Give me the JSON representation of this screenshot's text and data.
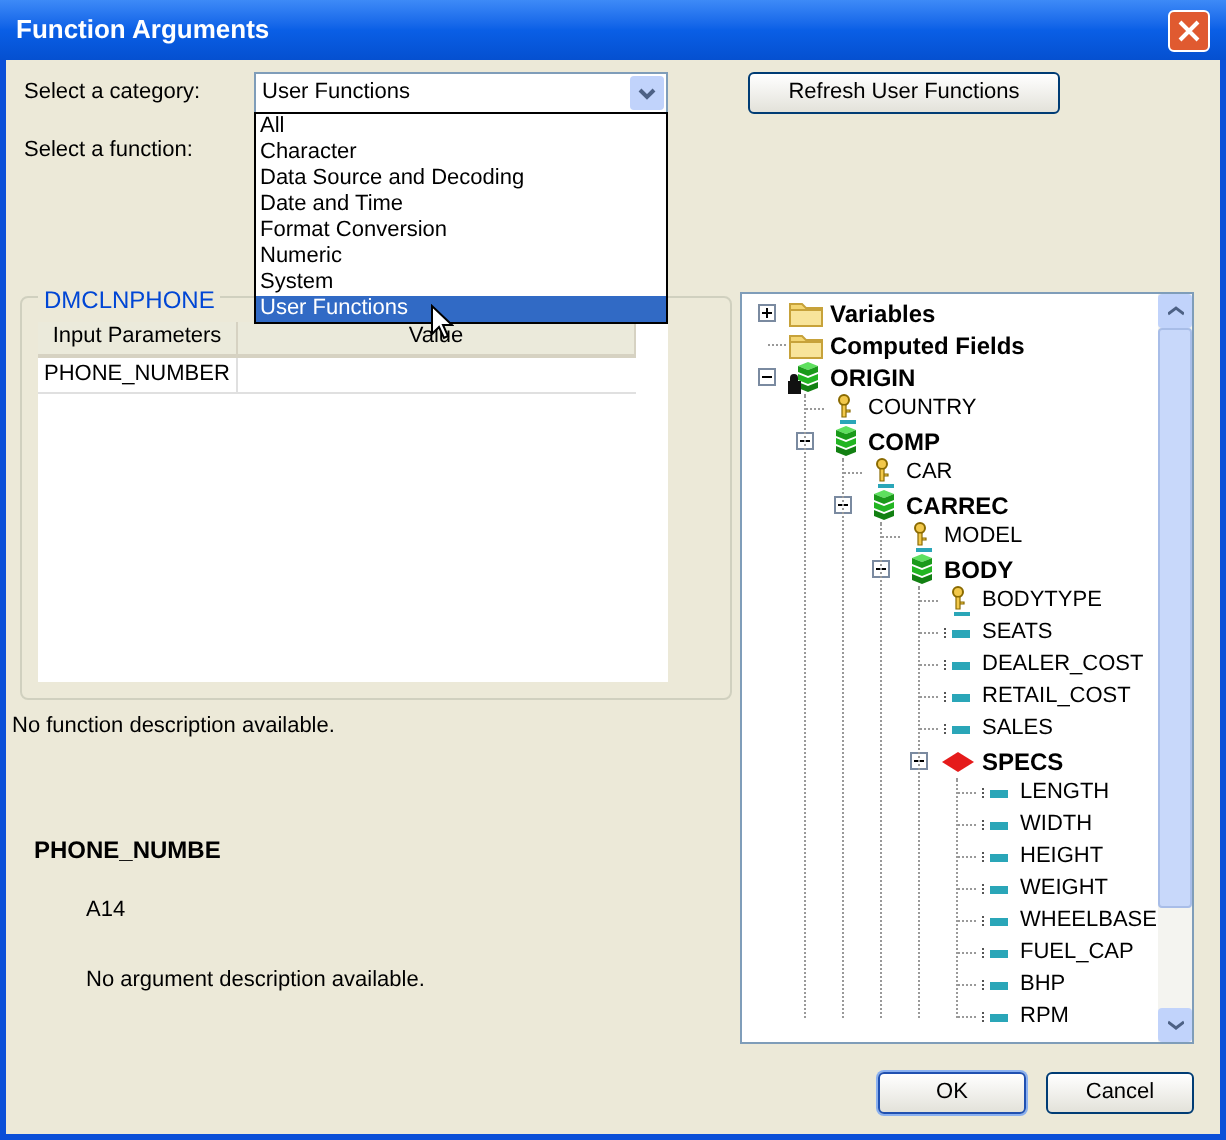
{
  "window": {
    "title": "Function Arguments"
  },
  "category": {
    "label": "Select a category:",
    "value": "User Functions",
    "options": [
      {
        "label": "All",
        "selected": false
      },
      {
        "label": "Character",
        "selected": false
      },
      {
        "label": "Data Source and Decoding",
        "selected": false
      },
      {
        "label": "Date and Time",
        "selected": false
      },
      {
        "label": "Format Conversion",
        "selected": false
      },
      {
        "label": "Numeric",
        "selected": false
      },
      {
        "label": "System",
        "selected": false
      },
      {
        "label": "User Functions",
        "selected": true
      }
    ]
  },
  "function": {
    "label": "Select a function:"
  },
  "refresh_button": "Refresh User Functions",
  "function_group": {
    "title": "DMCLNPHONE",
    "columns": [
      "Input Parameters",
      "Value"
    ],
    "rows": [
      {
        "parameter": "PHONE_NUMBER"
      }
    ]
  },
  "function_description": "No function description available.",
  "argument": {
    "name": "PHONE_NUMBE",
    "format": "A14",
    "description": "No argument description available."
  },
  "tree": [
    {
      "label": "Variables",
      "kind": "folder",
      "expanded": false
    },
    {
      "label": "Computed Fields",
      "kind": "folder"
    },
    {
      "label": "ORIGIN",
      "kind": "locked_segment",
      "expanded": true,
      "children": [
        {
          "label": "COUNTRY",
          "kind": "key"
        },
        {
          "label": "COMP",
          "kind": "segment",
          "expanded": true,
          "children": [
            {
              "label": "CAR",
              "kind": "key"
            },
            {
              "label": "CARREC",
              "kind": "segment",
              "expanded": true,
              "children": [
                {
                  "label": "MODEL",
                  "kind": "key"
                },
                {
                  "label": "BODY",
                  "kind": "segment",
                  "expanded": true,
                  "children": [
                    {
                      "label": "BODYTYPE",
                      "kind": "key"
                    },
                    {
                      "label": "SEATS",
                      "kind": "field"
                    },
                    {
                      "label": "DEALER_COST",
                      "kind": "field"
                    },
                    {
                      "label": "RETAIL_COST",
                      "kind": "field"
                    },
                    {
                      "label": "SALES",
                      "kind": "field"
                    },
                    {
                      "label": "SPECS",
                      "kind": "diamond",
                      "expanded": true,
                      "children": [
                        {
                          "label": "LENGTH",
                          "kind": "field"
                        },
                        {
                          "label": "WIDTH",
                          "kind": "field"
                        },
                        {
                          "label": "HEIGHT",
                          "kind": "field"
                        },
                        {
                          "label": "WEIGHT",
                          "kind": "field"
                        },
                        {
                          "label": "WHEELBASE",
                          "kind": "field"
                        },
                        {
                          "label": "FUEL_CAP",
                          "kind": "field"
                        },
                        {
                          "label": "BHP",
                          "kind": "field"
                        },
                        {
                          "label": "RPM",
                          "kind": "field"
                        }
                      ]
                    }
                  ]
                }
              ]
            }
          ]
        }
      ]
    }
  ],
  "buttons": [
    "OK",
    "Cancel"
  ]
}
